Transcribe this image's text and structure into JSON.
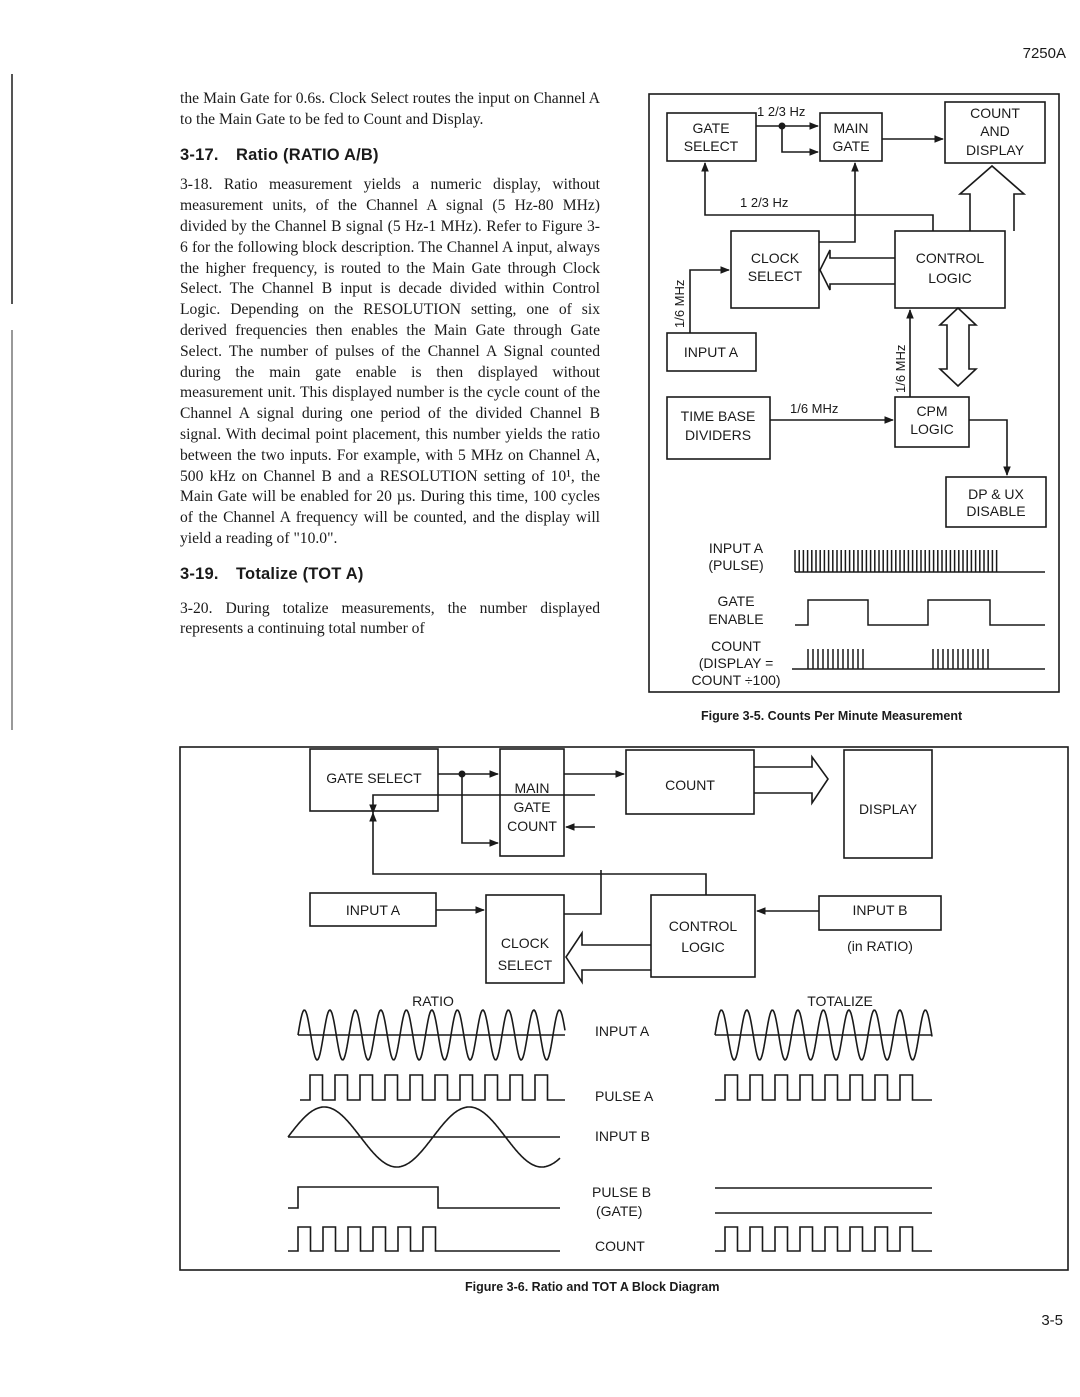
{
  "header": {
    "model": "7250A"
  },
  "footer": {
    "page_number": "3-5"
  },
  "text": {
    "intro": "the Main Gate for 0.6s. Clock Select routes the input on Channel A to the Main Gate to be fed to Count and Display.",
    "section_3_17": {
      "number": "3-17.",
      "title": "Ratio (RATIO A/B)"
    },
    "para_3_18": "3-18.  Ratio measurement yields a numeric display, without measurement units, of the Channel A signal (5 Hz-80 MHz) divided by the Channel B signal (5 Hz-1 MHz). Refer to Figure 3-6 for the following block description. The Channel A input, always the higher frequency, is routed to the Main Gate through Clock Select. The Channel B input is decade divided within Control Logic. Depending on the RESOLUTION setting, one of six derived frequencies then enables the Main Gate through Gate Select. The number of pulses of the Channel A Signal counted during the main gate enable is then displayed without measurement unit. This displayed number is the cycle count of the Channel A signal during one period of the divided Channel B signal. With decimal point placement, this number yields the ratio between the two inputs. For example, with 5 MHz on Channel A, 500 kHz on Channel B and a RESOLUTION setting of 10¹, the Main Gate will be enabled for 20 µs. During this time, 100 cycles of the Channel A frequency will be counted, and the display will yield a reading of \"10.0\".",
    "section_3_19": {
      "number": "3-19.",
      "title": "Totalize (TOT A)"
    },
    "para_3_20": "3-20.  During totalize measurements, the number displayed represents a continuing total number of"
  },
  "figure_3_5": {
    "caption": "Figure 3-5. Counts Per Minute Measurement",
    "blocks": {
      "gate_select": [
        "GATE",
        "SELECT"
      ],
      "main_gate": [
        "MAIN",
        "GATE"
      ],
      "count_display": [
        "COUNT",
        "AND",
        "DISPLAY"
      ],
      "clock_select": [
        "CLOCK",
        "SELECT"
      ],
      "control_logic": [
        "CONTROL",
        "LOGIC"
      ],
      "input_a": [
        "INPUT A"
      ],
      "time_base": [
        "TIME BASE",
        "DIVIDERS"
      ],
      "cpm_logic": [
        "CPM",
        "LOGIC"
      ],
      "dp_ux": [
        "DP & UX",
        "DISABLE"
      ]
    },
    "signal_labels": {
      "top_freq": "1 2/3 Hz",
      "feedback_freq": "1 2/3 Hz",
      "input_freq": "1/6 MHz",
      "timebase_freq": "1/6 MHz",
      "cpm_freq": "1/6 MHz"
    },
    "waveforms": {
      "input_a": [
        "INPUT A",
        "(PULSE)"
      ],
      "gate_enable": [
        "GATE",
        "ENABLE"
      ],
      "count": [
        "COUNT",
        "(DISPLAY =",
        "COUNT ÷100)"
      ]
    }
  },
  "figure_3_6": {
    "caption": "Figure 3-6. Ratio and TOT A Block Diagram",
    "blocks": {
      "gate_select": [
        "GATE SELECT"
      ],
      "main_gate_count": [
        "MAIN",
        "GATE",
        "COUNT"
      ],
      "count": [
        "COUNT"
      ],
      "display": [
        "DISPLAY"
      ],
      "input_a": [
        "INPUT A"
      ],
      "clock_select": [
        "CLOCK",
        "SELECT"
      ],
      "control_logic": [
        "CONTROL",
        "LOGIC"
      ],
      "input_b": [
        "INPUT B"
      ]
    },
    "input_b_note": "(in RATIO)",
    "mode_labels": {
      "ratio": "RATIO",
      "totalize": "TOTALIZE"
    },
    "waveform_labels": {
      "input_a": [
        "INPUT A"
      ],
      "pulse_a": [
        "PULSE A"
      ],
      "input_b": [
        "INPUT B"
      ],
      "pulse_b": [
        "PULSE B",
        "(GATE)"
      ],
      "count": [
        "COUNT"
      ]
    }
  }
}
